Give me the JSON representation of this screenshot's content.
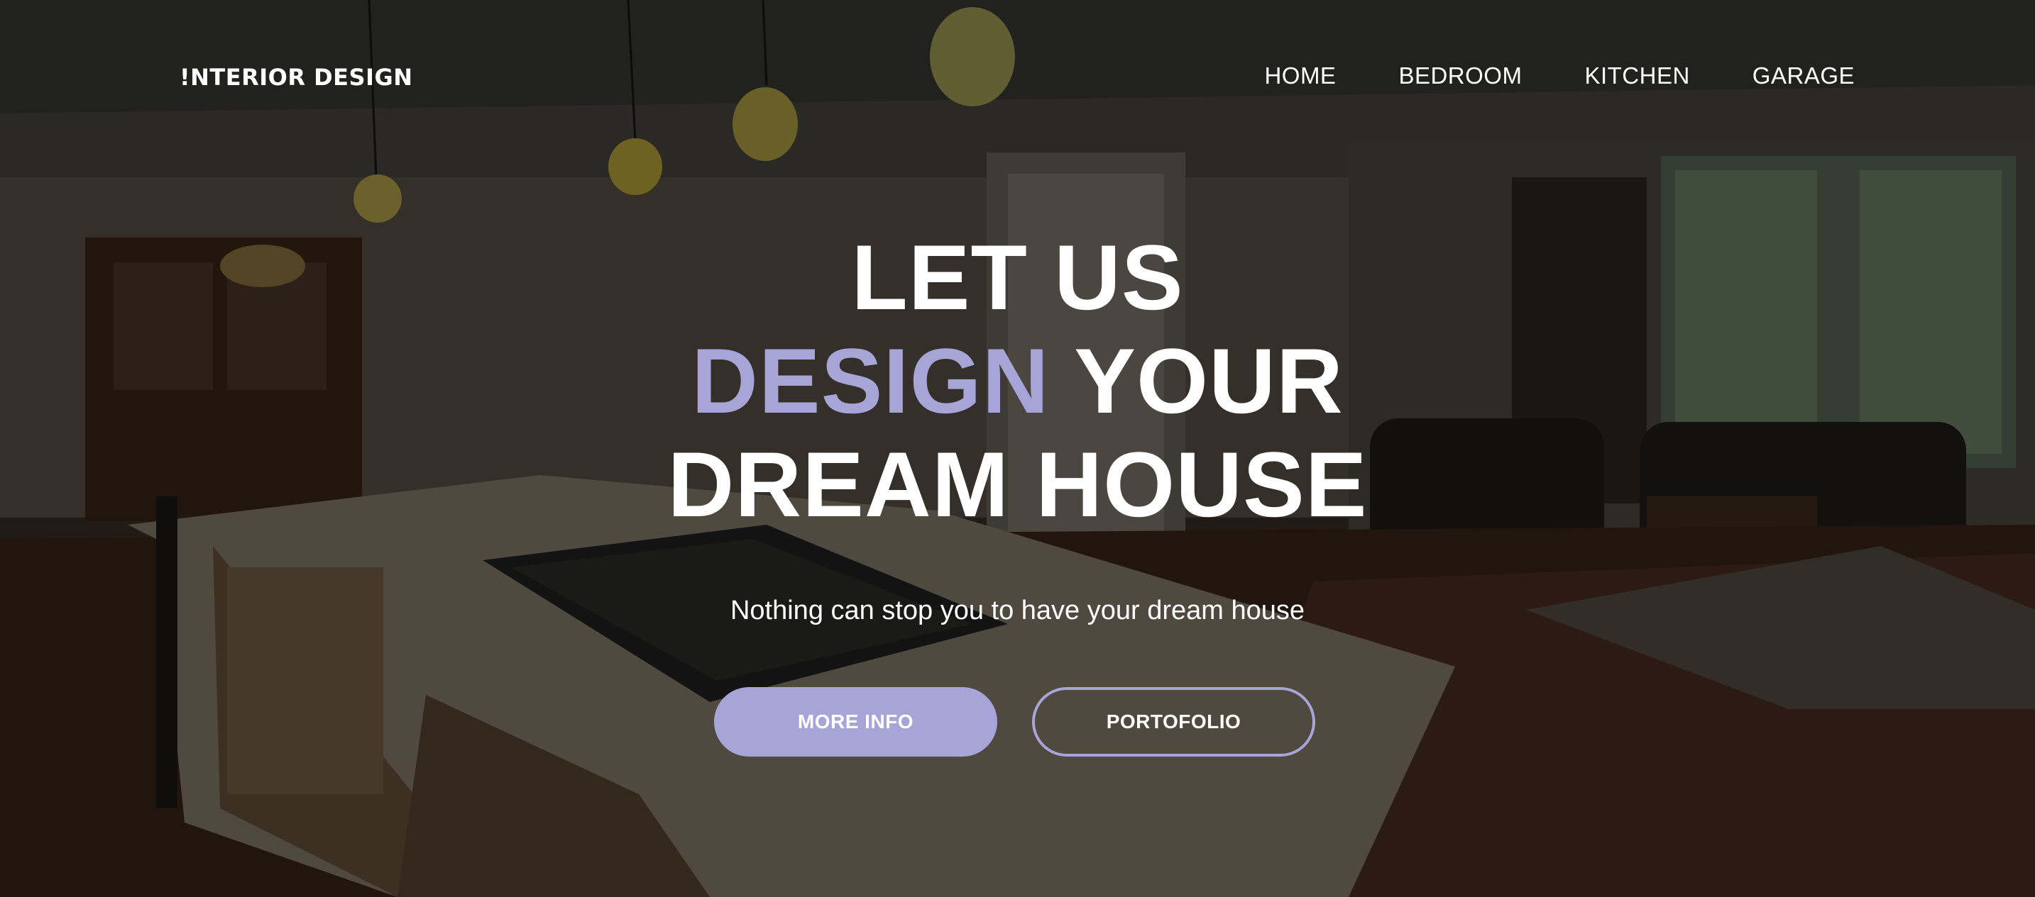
{
  "brand": {
    "logo_text": "!NTERIOR DESIGN"
  },
  "nav": {
    "items": [
      {
        "label": "HOME"
      },
      {
        "label": "BEDROOM"
      },
      {
        "label": "KITCHEN"
      },
      {
        "label": "GARAGE"
      }
    ]
  },
  "hero": {
    "headline_line1": "LET US",
    "headline_accent": "DESIGN",
    "headline_line2_rest": " YOUR",
    "headline_line3": "DREAM HOUSE",
    "subtitle": "Nothing can stop you to have your dream house",
    "primary_button": "MORE INFO",
    "secondary_button": "PORTOFOLIO"
  },
  "colors": {
    "accent": "#a7a4d8",
    "text": "#ffffff",
    "overlay": "rgba(0,0,0,0.42)"
  },
  "background": {
    "description_icon": "kitchen-interior-photo"
  }
}
